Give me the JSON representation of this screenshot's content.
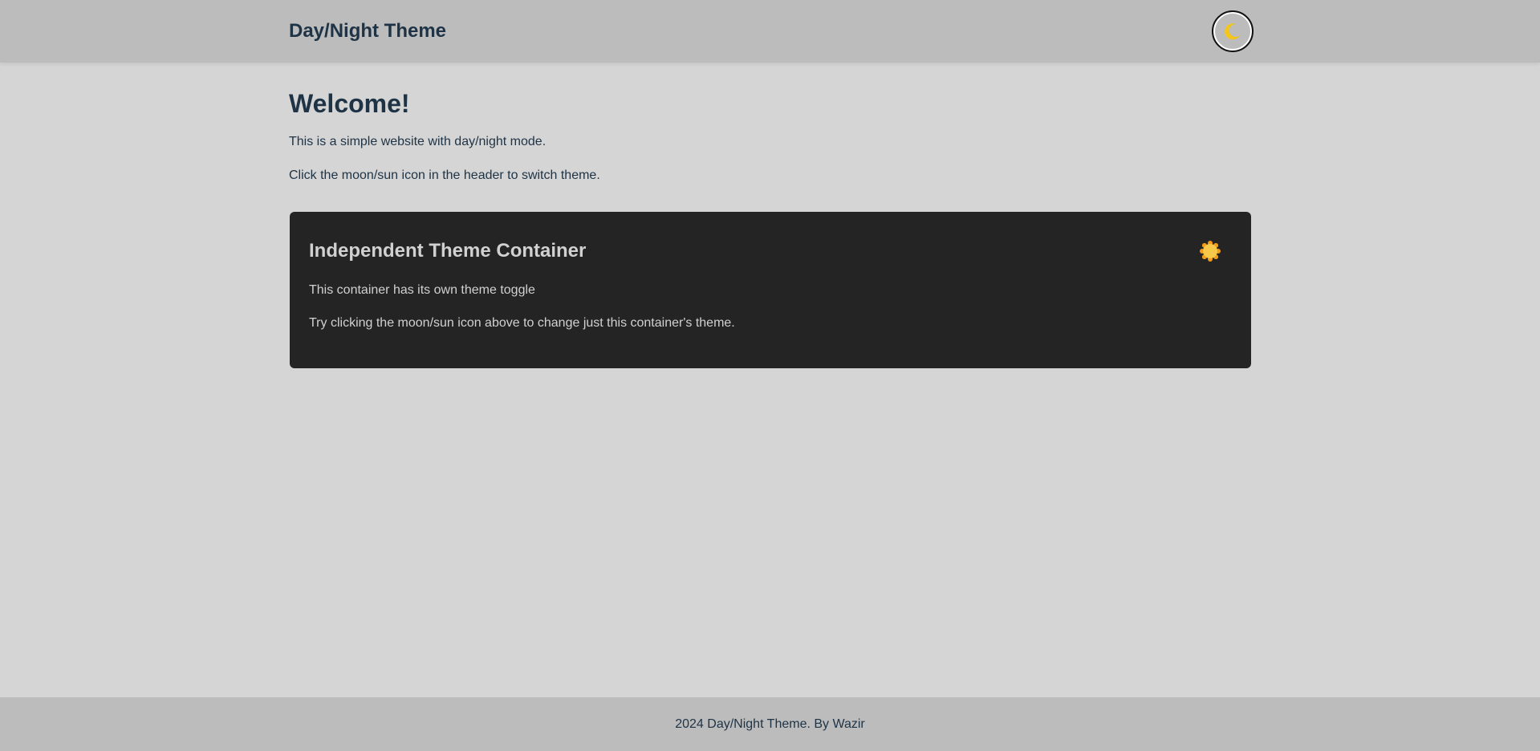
{
  "header": {
    "title": "Day/Night Theme",
    "toggle_icon": "moon-icon"
  },
  "main": {
    "heading": "Welcome!",
    "paragraphs": [
      "This is a simple website with day/night mode.",
      "Click the moon/sun icon in the header to switch theme."
    ]
  },
  "card": {
    "title": "Independent Theme Container",
    "toggle_icon": "sun-icon",
    "paragraphs": [
      "This container has its own theme toggle",
      "Try clicking the moon/sun icon above to change just this container's theme."
    ]
  },
  "footer": {
    "text": "2024 Day/Night Theme. By Wazir"
  },
  "colors": {
    "page_background": "#d5d5d5",
    "header_background": "#bcbcbc",
    "text_primary": "#1e3345",
    "card_background": "#242424",
    "card_text": "#d1d1d1",
    "moon": "#f5c518",
    "sun": "#f7c948"
  }
}
